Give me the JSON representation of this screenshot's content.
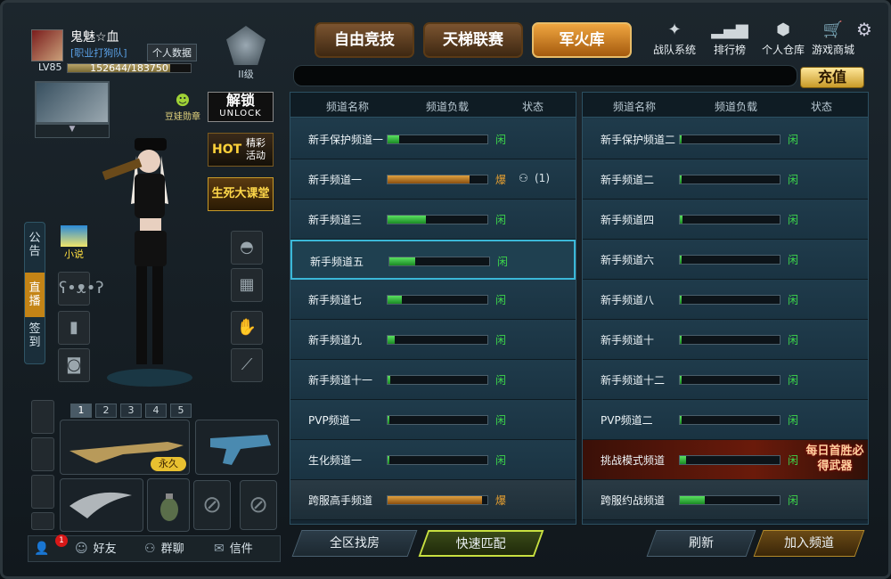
{
  "profile": {
    "name": "鬼魅☆血",
    "tag": "[职业打狗队]",
    "data_button": "个人数据",
    "level": "LV85",
    "xp_text": "152644/183750",
    "xp_fraction": 0.83
  },
  "rank": {
    "label": "II级"
  },
  "tabs": [
    {
      "label": "自由竞技",
      "active": false
    },
    {
      "label": "天梯联赛",
      "active": false
    },
    {
      "label": "军火库",
      "active": true
    }
  ],
  "top_icons": [
    {
      "label": "战队系统",
      "icon": "team-icon"
    },
    {
      "label": "排行榜",
      "icon": "ranking-icon"
    },
    {
      "label": "个人仓库",
      "icon": "warehouse-icon"
    },
    {
      "label": "游戏商城",
      "icon": "cart-icon"
    }
  ],
  "recharge_label": "充值",
  "side": {
    "badge": "豆娃勋章",
    "unlock_cn": "解锁",
    "unlock_en": "UNLOCK",
    "hot": "HOT",
    "hot_text": "精彩活动",
    "lecture": "生死大课堂",
    "novel": "小说",
    "tabs": [
      "公告",
      "直播",
      "签到"
    ],
    "active_tab": "直播"
  },
  "weapon_tabs": [
    "1",
    "2",
    "3",
    "4",
    "5"
  ],
  "weapon_badge": "永久",
  "bottom_bar": {
    "badge_count": "1",
    "friends": "好友",
    "group_chat": "群聊",
    "mail": "信件"
  },
  "channel_headers": {
    "name": "频道名称",
    "load": "频道负载",
    "status": "状态"
  },
  "left_channels": [
    {
      "name": "新手保护频道一",
      "load": 0.12,
      "status": "闲",
      "state": "idle"
    },
    {
      "name": "新手频道一",
      "load": 0.82,
      "status": "爆",
      "state": "full",
      "online": "(1)"
    },
    {
      "name": "新手频道三",
      "load": 0.38,
      "status": "闲",
      "state": "idle"
    },
    {
      "name": "新手频道五",
      "load": 0.26,
      "status": "闲",
      "state": "idle",
      "selected": true
    },
    {
      "name": "新手频道七",
      "load": 0.14,
      "status": "闲",
      "state": "idle"
    },
    {
      "name": "新手频道九",
      "load": 0.07,
      "status": "闲",
      "state": "idle"
    },
    {
      "name": "新手频道十一",
      "load": 0.03,
      "status": "闲",
      "state": "idle"
    },
    {
      "name": "PVP频道一",
      "load": 0.01,
      "status": "闲",
      "state": "idle"
    },
    {
      "name": "生化频道一",
      "load": 0.02,
      "status": "闲",
      "state": "idle"
    },
    {
      "name": "跨服高手频道",
      "load": 0.95,
      "status": "爆",
      "state": "full",
      "alt": true
    }
  ],
  "right_channels": [
    {
      "name": "新手保护频道二",
      "load": 0.02,
      "status": "闲",
      "state": "idle"
    },
    {
      "name": "新手频道二",
      "load": 0.02,
      "status": "闲",
      "state": "idle"
    },
    {
      "name": "新手频道四",
      "load": 0.03,
      "status": "闲",
      "state": "idle"
    },
    {
      "name": "新手频道六",
      "load": 0.02,
      "status": "闲",
      "state": "idle"
    },
    {
      "name": "新手频道八",
      "load": 0.02,
      "status": "闲",
      "state": "idle"
    },
    {
      "name": "新手频道十",
      "load": 0.02,
      "status": "闲",
      "state": "idle"
    },
    {
      "name": "新手频道十二",
      "load": 0.02,
      "status": "闲",
      "state": "idle"
    },
    {
      "name": "PVP频道二",
      "load": 0.01,
      "status": "闲",
      "state": "idle"
    },
    {
      "name": "挑战模式频道",
      "load": 0.06,
      "status": "闲",
      "state": "idle",
      "promo": true
    },
    {
      "name": "跨服约战频道",
      "load": 0.25,
      "status": "闲",
      "state": "idle",
      "alt": true
    }
  ],
  "promo_text": "每日首胜必得武器",
  "footer": {
    "all_find": "全区找房",
    "quick_match": "快速匹配",
    "refresh": "刷新",
    "join": "加入频道"
  },
  "colors": {
    "idle": "#3dd84a",
    "full": "#e8a030",
    "accent": "#c48416"
  }
}
